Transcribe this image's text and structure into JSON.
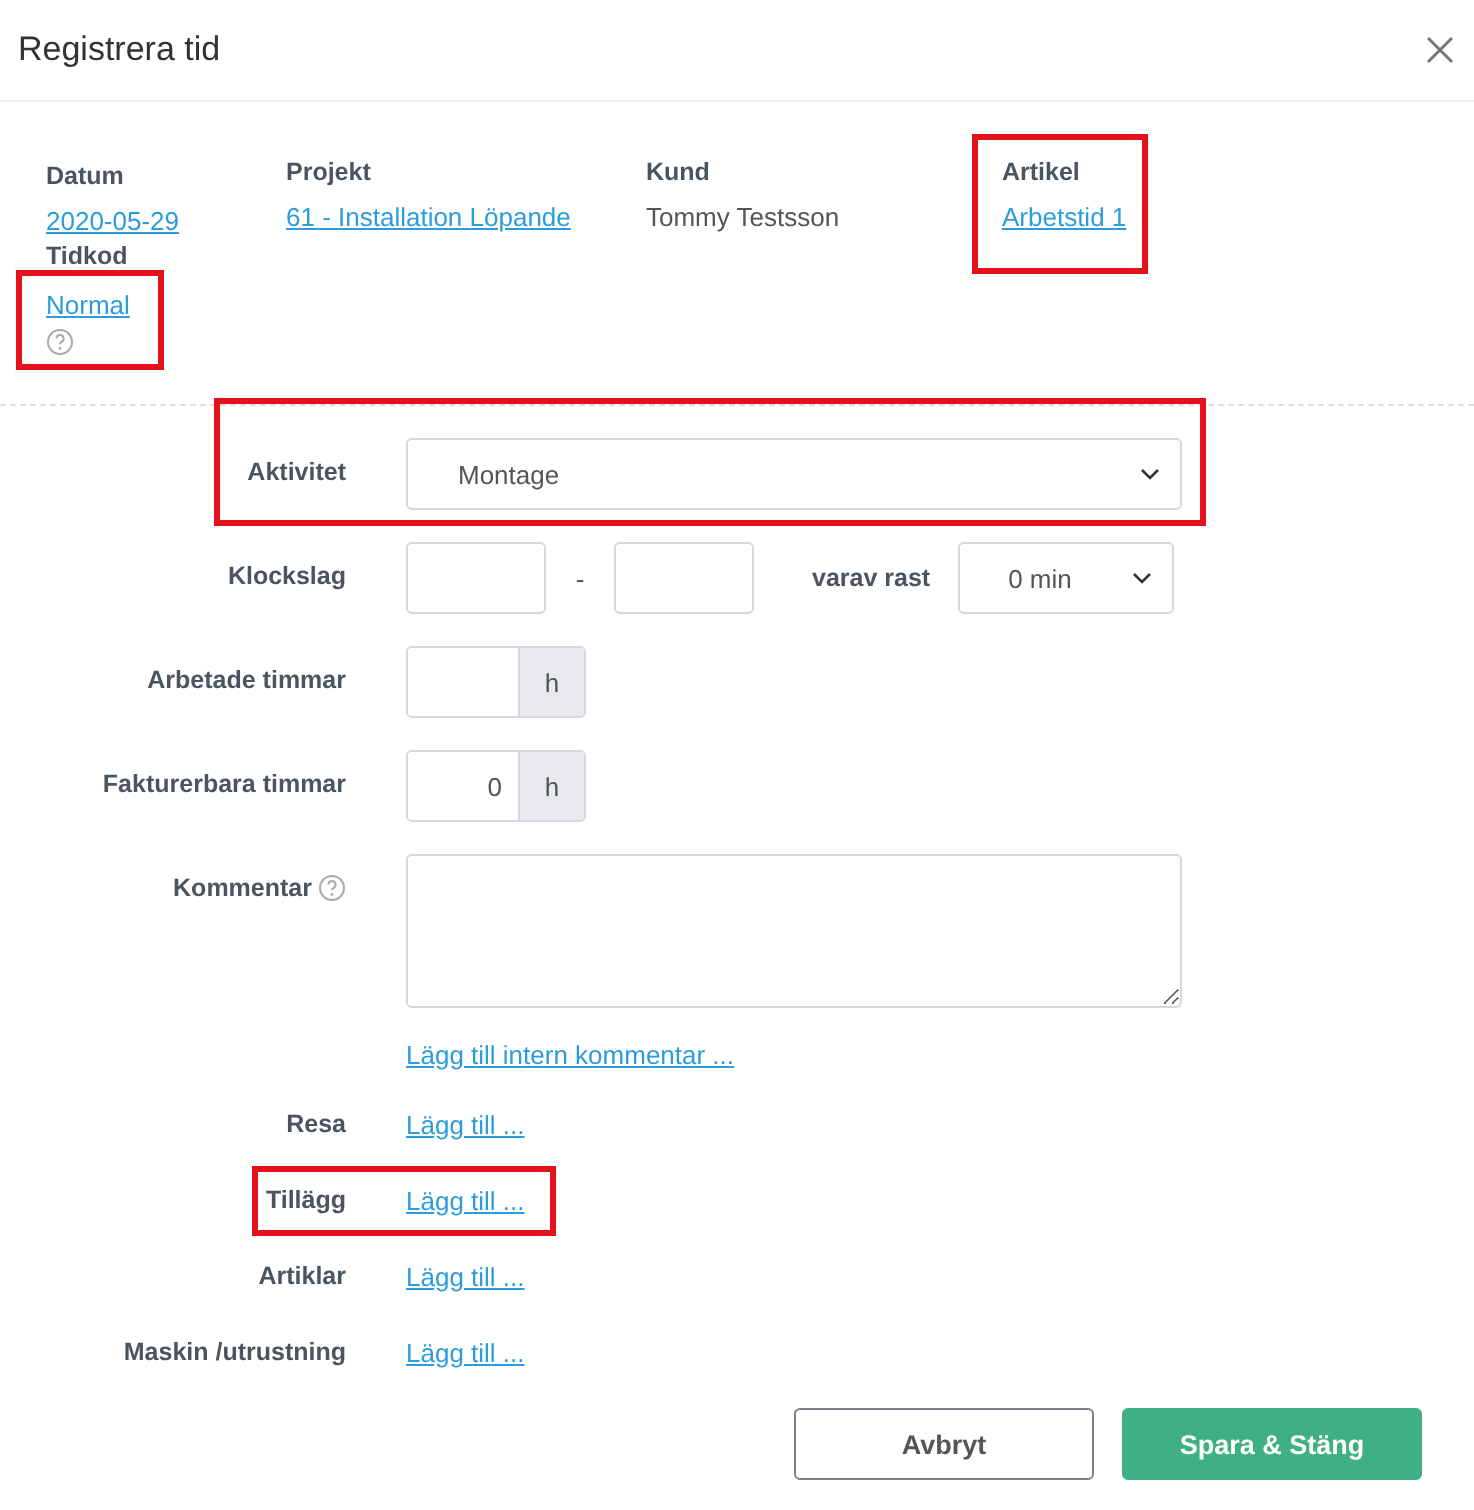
{
  "dialog": {
    "title": "Registrera tid"
  },
  "info": [
    {
      "label": "Datum",
      "value": "2020-05-29",
      "kind": "link",
      "highlighted": false
    },
    {
      "label": "Projekt",
      "value": "61 - Installation Löpande",
      "kind": "link",
      "highlighted": false
    },
    {
      "label": "Kund",
      "value": "Tommy Testsson",
      "kind": "text",
      "highlighted": false
    },
    {
      "label": "Artikel",
      "value": "Arbetstid 1",
      "kind": "link",
      "highlighted": true
    }
  ],
  "timecode": {
    "label": "Tidkod",
    "value": "Normal",
    "highlighted": true
  },
  "form": {
    "rows": [
      {
        "kind": "select",
        "label": "Aktivitet",
        "value": "Montage",
        "help": false,
        "highlighted": true
      },
      {
        "kind": "time",
        "label": "Klockslag",
        "separator": "-",
        "break_label": "varav rast",
        "break_value": "0 min",
        "help": false,
        "highlighted": false
      },
      {
        "kind": "hours",
        "label": "Arbetade timmar",
        "unit": "h",
        "help": false,
        "highlighted": false
      },
      {
        "kind": "hours",
        "label": "Fakturerbara timmar",
        "value": "0",
        "unit": "h",
        "help": false,
        "highlighted": false
      },
      {
        "kind": "textarea",
        "label": "Kommentar",
        "help": true,
        "highlighted": false
      },
      {
        "kind": "link",
        "link": "Lägg till intern kommentar ...",
        "help": false,
        "highlighted": false
      }
    ]
  },
  "extras": [
    {
      "label": "Resa",
      "link": "Lägg till ...",
      "highlighted": false
    },
    {
      "label": "Tillägg",
      "link": "Lägg till ...",
      "highlighted": true
    },
    {
      "label": "Artiklar",
      "link": "Lägg till ...",
      "highlighted": false
    },
    {
      "label": "Maskin /utrustning",
      "link": "Lägg till ...",
      "highlighted": false
    }
  ],
  "buttons": [
    {
      "label": "Avbryt",
      "kind": "secondary"
    },
    {
      "label": "Spara & Stäng",
      "kind": "primary"
    }
  ]
}
